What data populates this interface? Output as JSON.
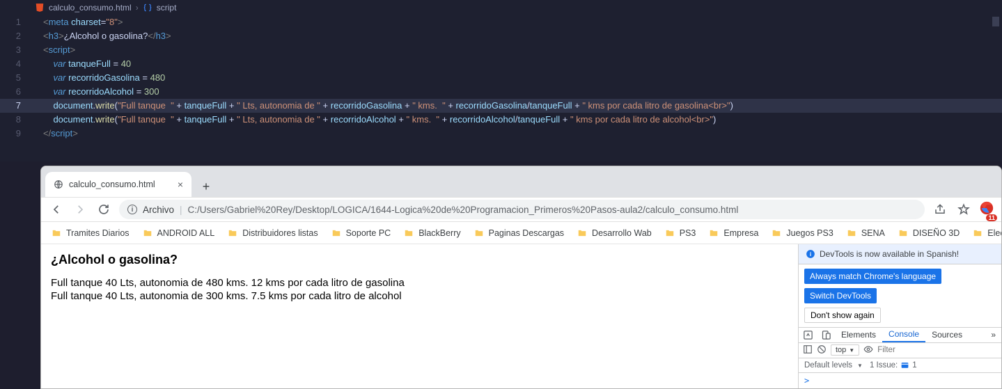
{
  "breadcrumbs": {
    "file": "calculo_consumo.html",
    "node": "script"
  },
  "code": {
    "l1": {
      "tag1": "<",
      "meta": "meta",
      "sp": " ",
      "attr": "charset",
      "eq": "=",
      "val": "\"8\"",
      "tag2": ">"
    },
    "l2": {
      "o": "<",
      "h3o": "h3",
      "c": ">",
      "txt": "¿Alcohol o gasolina?",
      "o2": "</",
      "h3c": "h3",
      "c2": ">"
    },
    "l3": {
      "o": "<",
      "s": "script",
      "c": ">"
    },
    "l4": {
      "kw": "var",
      "id": "tanqueFull",
      "eq": " = ",
      "num": "40"
    },
    "l5": {
      "kw": "var",
      "id": "recorridoGasolina",
      "eq": " = ",
      "num": "480"
    },
    "l6": {
      "kw": "var",
      "id": "recorridoAlcohol",
      "eq": " = ",
      "num": "300"
    },
    "l7": {
      "obj": "document",
      "dot": ".",
      "fn": "write",
      "po": "(",
      "s1": "\"Full tanque  \"",
      "p1": " + ",
      "v1": "tanqueFull",
      "p2": " + ",
      "s2": "\" Lts, autonomia de \"",
      "p3": " + ",
      "v2": "recorridoGasolina",
      "p4": " + ",
      "s3": "\" kms.  \"",
      "p5": " + ",
      "v3": "recorridoGasolina",
      "sl": "/",
      "v4": "tanqueFull",
      "p6": " + ",
      "s4": "\" kms por cada litro de gasolina<br>\"",
      "pc": ")"
    },
    "l8": {
      "obj": "document",
      "dot": ".",
      "fn": "write",
      "po": "(",
      "s1": "\"Full tanque  \"",
      "p1": " + ",
      "v1": "tanqueFull",
      "p2": " + ",
      "s2": "\" Lts, autonomia de \"",
      "p3": " + ",
      "v2": "recorridoAlcohol",
      "p4": " + ",
      "s3": "\" kms.  \"",
      "p5": " + ",
      "v3": "recorridoAlcohol",
      "sl": "/",
      "v4": "tanqueFull",
      "p6": " + ",
      "s4": "\" kms por cada litro de alcohol<br>\"",
      "pc": ")"
    },
    "l9": {
      "o": "</",
      "s": "script",
      "c": ">"
    },
    "lineNums": {
      "1": "1",
      "2": "2",
      "3": "3",
      "4": "4",
      "5": "5",
      "6": "6",
      "7": "7",
      "8": "8",
      "9": "9"
    }
  },
  "tab": {
    "title": "calculo_consumo.html"
  },
  "addr": {
    "archivo": "Archivo",
    "url": "C:/Users/Gabriel%20Rey/Desktop/LOGICA/1644-Logica%20de%20Programacion_Primeros%20Pasos-aula2/calculo_consumo.html"
  },
  "extBadge": "11",
  "bookmarks": [
    "Tramites Diarios",
    "ANDROID ALL",
    "Distribuidores listas",
    "Soporte PC",
    "BlackBerry",
    "Paginas Descargas",
    "Desarrollo Wab",
    "PS3",
    "Empresa",
    "Juegos PS3",
    "SENA",
    "DISEÑO 3D",
    "Electronica"
  ],
  "page": {
    "title": "¿Alcohol o gasolina?",
    "line1": "Full tanque 40 Lts, autonomia de 480 kms. 12 kms por cada litro de gasolina",
    "line2": "Full tanque 40 Lts, autonomia de 300 kms. 7.5 kms por cada litro de alcohol"
  },
  "devtools": {
    "banner": "DevTools is now available in Spanish!",
    "btn1": "Always match Chrome's language",
    "btn2": "Switch DevTools",
    "btn3": "Don't show again",
    "tabs": {
      "elements": "Elements",
      "console": "Console",
      "sources": "Sources",
      "more": "»"
    },
    "top": "top",
    "filterPlaceholder": "Filter",
    "defaultLevels": "Default levels",
    "issueLabel": "1 Issue:",
    "issueCount": "1",
    "prompt": ">"
  }
}
